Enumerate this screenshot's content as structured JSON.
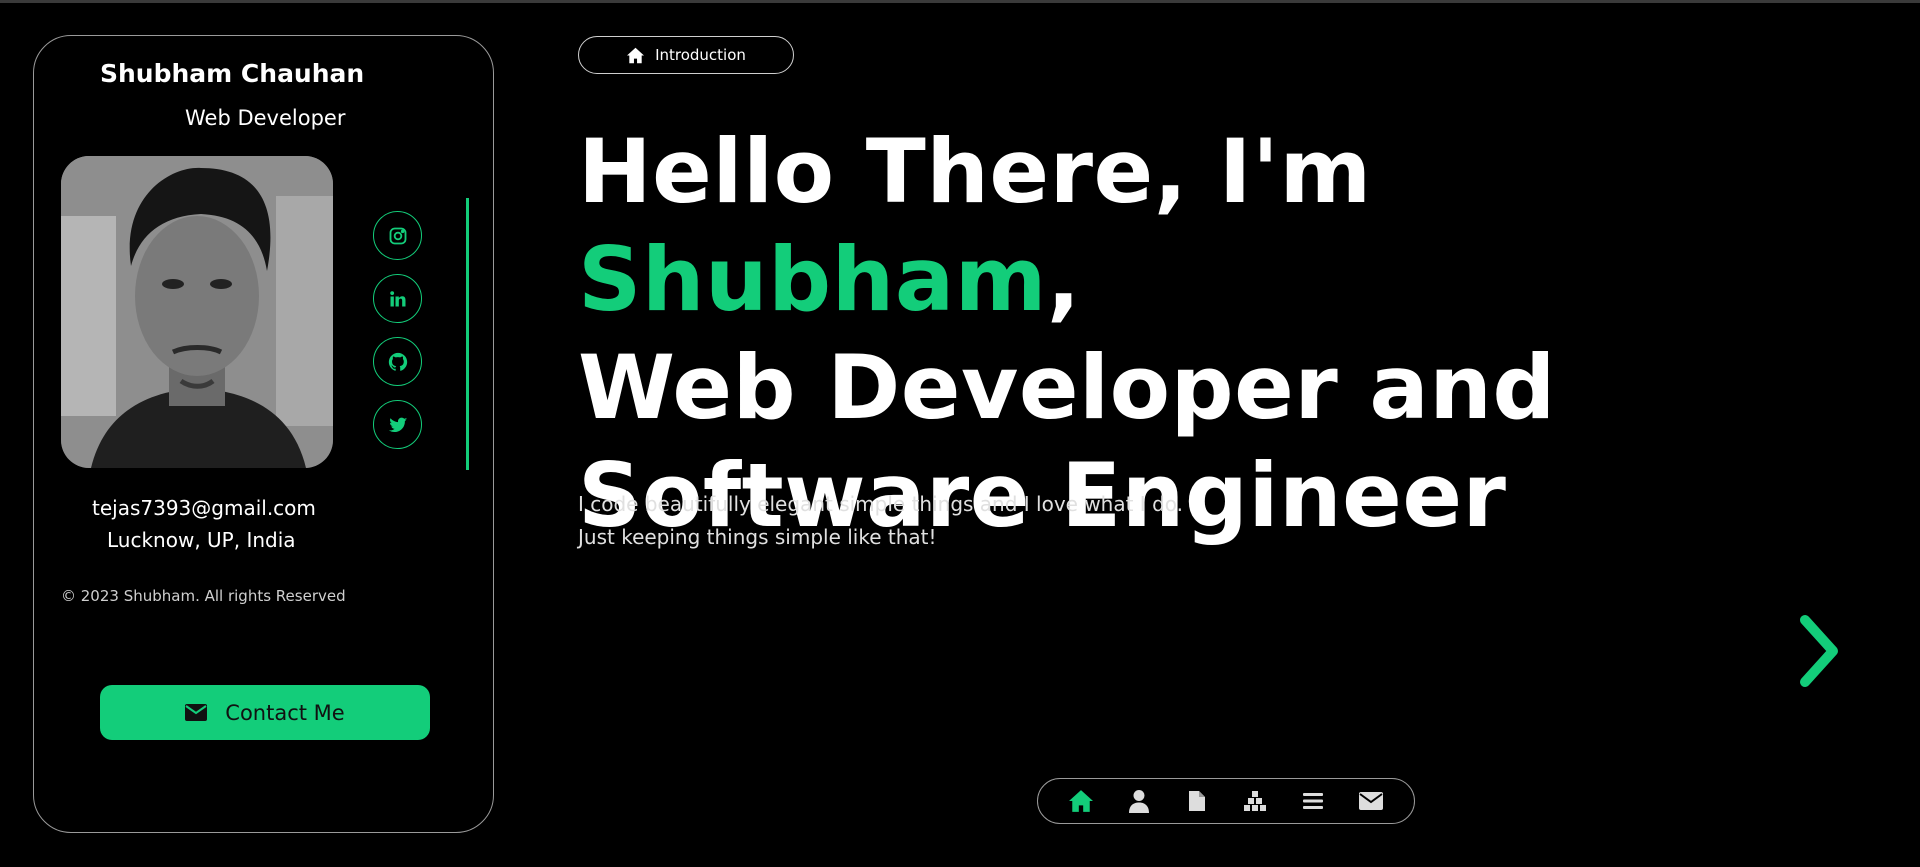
{
  "profile": {
    "name": "Shubham Chauhan",
    "role": "Web Developer",
    "email": "tejas7393@gmail.com",
    "location": "Lucknow, UP, India",
    "copyright": "© 2023 Shubham. All rights Reserved",
    "contact_label": "Contact Me",
    "social": [
      "instagram-icon",
      "linkedin-icon",
      "github-icon",
      "twitter-icon"
    ]
  },
  "intro": {
    "pill_label": "Introduction",
    "headline_prefix": "Hello There, I'm ",
    "headline_name": "Shubham",
    "headline_comma": ",",
    "headline_line2": "Web Developer and",
    "headline_line3": "Software Engineer",
    "desc_line1": "I code beautifully elegant simple things and I love what I do.",
    "desc_line2": "Just keeping things simple like that!"
  },
  "nav": {
    "items": [
      "home-icon",
      "user-icon",
      "document-icon",
      "skills-icon",
      "menu-icon",
      "mail-icon"
    ],
    "active": "home-icon"
  },
  "colors": {
    "accent": "#13cd7a",
    "background": "#000000",
    "text": "#ffffff"
  }
}
